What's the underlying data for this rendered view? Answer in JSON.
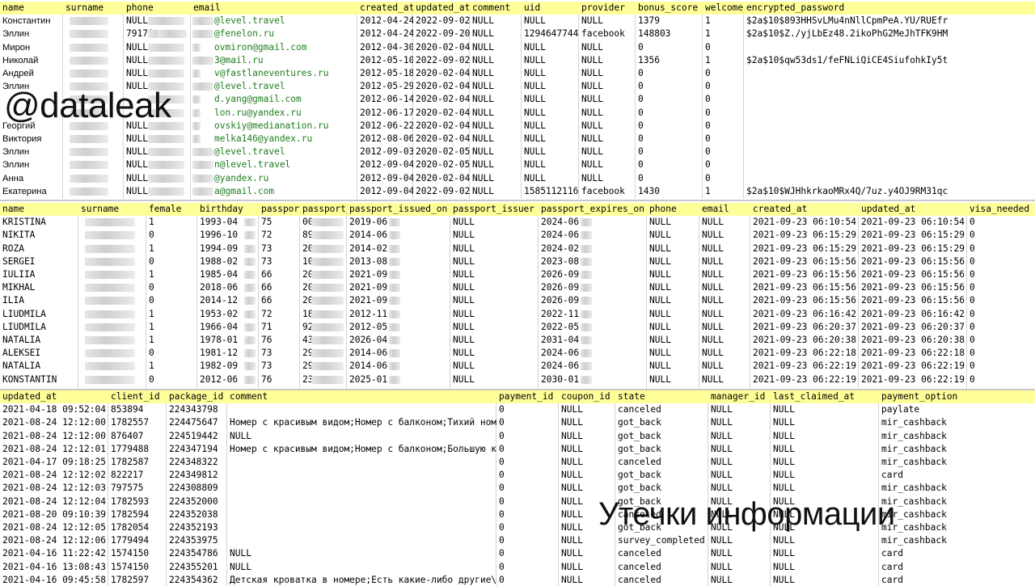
{
  "watermark_top": "@dataleak",
  "watermark_bottom": "Утечки информации",
  "table1": {
    "headers": [
      "name",
      "surname",
      "phone",
      "email",
      "created_at",
      "updated_at",
      "comment",
      "uid",
      "provider",
      "bonus_score",
      "welcome_",
      "encrypted_password"
    ],
    "rows": [
      [
        "Константин",
        "",
        "NULL",
        "@level.travel",
        "2012-04-24",
        "2022-09-02",
        "NULL",
        "NULL",
        "NULL",
        "1379",
        "1",
        "$2a$10$893HHSvLMu4nNllCpmPeA.YU/RUEfr"
      ],
      [
        "Эллин",
        "",
        "79179",
        "@fenelon.ru",
        "2012-04-24",
        "2022-09-20",
        "NULL",
        "1294647744",
        "facebook",
        "148803",
        "1",
        "$2a$10$Z./yjLbEz48.2ikoPhG2MeJhTFK9HM"
      ],
      [
        "Мирон",
        "",
        "NULL",
        "ovmiron@gmail.com",
        "2012-04-30",
        "2020-02-04",
        "NULL",
        "NULL",
        "NULL",
        "0",
        "0",
        ""
      ],
      [
        "Николай",
        "",
        "NULL",
        "3@mail.ru",
        "2012-05-10",
        "2022-09-02",
        "NULL",
        "NULL",
        "NULL",
        "1356",
        "1",
        "$2a$10$qw53ds1/feFNLiQiCE4SiufohkIy5t"
      ],
      [
        "Андрей",
        "",
        "NULL",
        "v@fastlaneventures.ru",
        "2012-05-18",
        "2020-02-04",
        "NULL",
        "NULL",
        "NULL",
        "0",
        "0",
        ""
      ],
      [
        "Эллин",
        "",
        "NULL",
        "@level.travel",
        "2012-05-29",
        "2020-02-04",
        "NULL",
        "NULL",
        "NULL",
        "0",
        "0",
        ""
      ],
      [
        "",
        "",
        "",
        "d.yang@gmail.com",
        "2012-06-14",
        "2020-02-04",
        "NULL",
        "NULL",
        "NULL",
        "0",
        "0",
        ""
      ],
      [
        "",
        "",
        "",
        "lon.ru@yandex.ru",
        "2012-06-17",
        "2020-02-04",
        "NULL",
        "NULL",
        "NULL",
        "0",
        "0",
        ""
      ],
      [
        "Георгий",
        "",
        "NULL",
        "ovskiy@medianation.ru",
        "2012-06-22",
        "2020-02-04",
        "NULL",
        "NULL",
        "NULL",
        "0",
        "0",
        ""
      ],
      [
        "Виктория",
        "",
        "NULL",
        "melka146@yandex.ru",
        "2012-08-06",
        "2020-02-04",
        "NULL",
        "NULL",
        "NULL",
        "0",
        "0",
        ""
      ],
      [
        "Эллин",
        "",
        "NULL",
        "@level.travel",
        "2012-09-03",
        "2020-02-05",
        "NULL",
        "NULL",
        "NULL",
        "0",
        "0",
        ""
      ],
      [
        "Эллин",
        "",
        "NULL",
        "n@level.travel",
        "2012-09-04",
        "2020-02-05",
        "NULL",
        "NULL",
        "NULL",
        "0",
        "0",
        ""
      ],
      [
        "Анна",
        "",
        "NULL",
        "@yandex.ru",
        "2012-09-04",
        "2020-02-04",
        "NULL",
        "NULL",
        "NULL",
        "0",
        "0",
        ""
      ],
      [
        "Екатерина",
        "",
        "NULL",
        "a@gmail.com",
        "2012-09-04",
        "2022-09-02",
        "NULL",
        "1585112116",
        "facebook",
        "1430",
        "1",
        "$2a$10$WJHhkrkaoMRx4Q/7uz.y4OJ9RM31qc"
      ]
    ]
  },
  "table2": {
    "headers": [
      "name",
      "surname",
      "female",
      "birthday",
      "passport",
      "passport_",
      "passport_issued_on",
      "passport_issuer",
      "passport_expires_on",
      "phone",
      "email",
      "created_at",
      "updated_at",
      "visa_needed"
    ],
    "rows": [
      [
        "KRISTINA",
        "",
        "1",
        "1993-04",
        "75",
        "00",
        "2019-06-",
        "NULL",
        "2024-06-",
        "NULL",
        "NULL",
        "2021-09-23 06:10:54",
        "2021-09-23 06:10:54",
        "0"
      ],
      [
        "NIKITA",
        "",
        "0",
        "1996-10",
        "72",
        "89",
        "2014-06-",
        "NULL",
        "2024-06-",
        "NULL",
        "NULL",
        "2021-09-23 06:15:29",
        "2021-09-23 06:15:29",
        "0"
      ],
      [
        "ROZA",
        "",
        "1",
        "1994-09",
        "73",
        "20",
        "2014-02-",
        "NULL",
        "2024-02-",
        "NULL",
        "NULL",
        "2021-09-23 06:15:29",
        "2021-09-23 06:15:29",
        "0"
      ],
      [
        "SERGEI",
        "",
        "0",
        "1988-02",
        "73",
        "10",
        "2013-08-",
        "NULL",
        "2023-08-",
        "NULL",
        "NULL",
        "2021-09-23 06:15:56",
        "2021-09-23 06:15:56",
        "0"
      ],
      [
        "IULIIA",
        "",
        "1",
        "1985-04",
        "66",
        "20",
        "2021-09-",
        "NULL",
        "2026-09-",
        "NULL",
        "NULL",
        "2021-09-23 06:15:56",
        "2021-09-23 06:15:56",
        "0"
      ],
      [
        "MIKHAL",
        "",
        "0",
        "2018-06",
        "66",
        "20",
        "2021-09-",
        "NULL",
        "2026-09-",
        "NULL",
        "NULL",
        "2021-09-23 06:15:56",
        "2021-09-23 06:15:56",
        "0"
      ],
      [
        "ILIA",
        "",
        "0",
        "2014-12",
        "66",
        "20",
        "2021-09-",
        "NULL",
        "2026-09-",
        "NULL",
        "NULL",
        "2021-09-23 06:15:56",
        "2021-09-23 06:15:56",
        "0"
      ],
      [
        "LIUDMILA",
        "",
        "1",
        "1953-02",
        "72",
        "18",
        "2012-11-",
        "NULL",
        "2022-11-",
        "NULL",
        "NULL",
        "2021-09-23 06:16:42",
        "2021-09-23 06:16:42",
        "0"
      ],
      [
        "LIUDMILA",
        "",
        "1",
        "1966-04",
        "71",
        "92",
        "2012-05-",
        "NULL",
        "2022-05-",
        "NULL",
        "NULL",
        "2021-09-23 06:20:37",
        "2021-09-23 06:20:37",
        "0"
      ],
      [
        "NATALIA",
        "",
        "1",
        "1978-01",
        "76",
        "43",
        "2026-04-",
        "NULL",
        "2031-04-",
        "NULL",
        "NULL",
        "2021-09-23 06:20:38",
        "2021-09-23 06:20:38",
        "0"
      ],
      [
        "ALEKSEI",
        "",
        "0",
        "1981-12",
        "73",
        "29",
        "2014-06-",
        "NULL",
        "2024-06-",
        "NULL",
        "NULL",
        "2021-09-23 06:22:18",
        "2021-09-23 06:22:18",
        "0"
      ],
      [
        "NATALIA",
        "",
        "1",
        "1982-09",
        "73",
        "29",
        "2014-06-",
        "NULL",
        "2024-06-",
        "NULL",
        "NULL",
        "2021-09-23 06:22:19",
        "2021-09-23 06:22:19",
        "0"
      ],
      [
        "KONSTANTIN",
        "",
        "0",
        "2012-06",
        "76",
        "23",
        "2025-01-",
        "NULL",
        "2030-01-",
        "NULL",
        "NULL",
        "2021-09-23 06:22:19",
        "2021-09-23 06:22:19",
        "0"
      ]
    ]
  },
  "table3": {
    "headers": [
      "updated_at",
      "client_id",
      "package_id",
      "comment",
      "payment_id",
      "coupon_id",
      "state",
      "manager_id",
      "last_claimed_at",
      "payment_option"
    ],
    "rows": [
      [
        "2021-04-18 09:52:04",
        "853894",
        "224343798",
        "",
        "0",
        "NULL",
        "canceled",
        "NULL",
        "NULL",
        "paylate"
      ],
      [
        "2021-08-24 12:12:00",
        "1782557",
        "224475647",
        "Номер с красивым видом;Номер с балконом;Тихий номер;",
        "0",
        "NULL",
        "got_back",
        "NULL",
        "NULL",
        "mir_cashback"
      ],
      [
        "2021-08-24 12:12:00",
        "876407",
        "224519442",
        "NULL",
        "0",
        "NULL",
        "got_back",
        "NULL",
        "NULL",
        "mir_cashback"
      ],
      [
        "2021-08-24 12:12:01",
        "1779488",
        "224347194",
        "Номер с красивым видом;Номер с балконом;Большую кров",
        "0",
        "NULL",
        "got_back",
        "NULL",
        "NULL",
        "mir_cashback"
      ],
      [
        "2021-04-17 09:18:25",
        "1782587",
        "224348322",
        "",
        "0",
        "NULL",
        "canceled",
        "NULL",
        "NULL",
        "mir_cashback"
      ],
      [
        "2021-08-24 12:12:02",
        "822217",
        "224349812",
        "",
        "0",
        "NULL",
        "got_back",
        "NULL",
        "NULL",
        "card"
      ],
      [
        "2021-08-24 12:12:03",
        "797575",
        "224308809",
        "",
        "0",
        "NULL",
        "got_back",
        "NULL",
        "NULL",
        "mir_cashback"
      ],
      [
        "2021-08-24 12:12:04",
        "1782593",
        "224352000",
        "",
        "0",
        "NULL",
        "got_back",
        "NULL",
        "NULL",
        "mir_cashback"
      ],
      [
        "2021-08-20 09:10:39",
        "1782594",
        "224352038",
        "",
        "0",
        "NULL",
        "canceled",
        "NULL",
        "NULL",
        "mir_cashback"
      ],
      [
        "2021-08-24 12:12:05",
        "1782054",
        "224352193",
        "",
        "0",
        "NULL",
        "got_back",
        "NULL",
        "NULL",
        "mir_cashback"
      ],
      [
        "2021-08-24 12:12:06",
        "1779494",
        "224353975",
        "",
        "0",
        "NULL",
        "survey_completed",
        "NULL",
        "NULL",
        "mir_cashback"
      ],
      [
        "2021-04-16 11:22:42",
        "1574150",
        "224354786",
        "NULL",
        "0",
        "NULL",
        "canceled",
        "NULL",
        "NULL",
        "card"
      ],
      [
        "2021-04-16 13:08:43",
        "1574150",
        "224355201",
        "NULL",
        "0",
        "NULL",
        "canceled",
        "NULL",
        "NULL",
        "card"
      ],
      [
        "2021-04-16 09:45:58",
        "1782597",
        "224354362",
        "Детская кроватка в номере;Есть какие-либо другие\\по",
        "0",
        "NULL",
        "canceled",
        "NULL",
        "NULL",
        "card"
      ]
    ]
  }
}
